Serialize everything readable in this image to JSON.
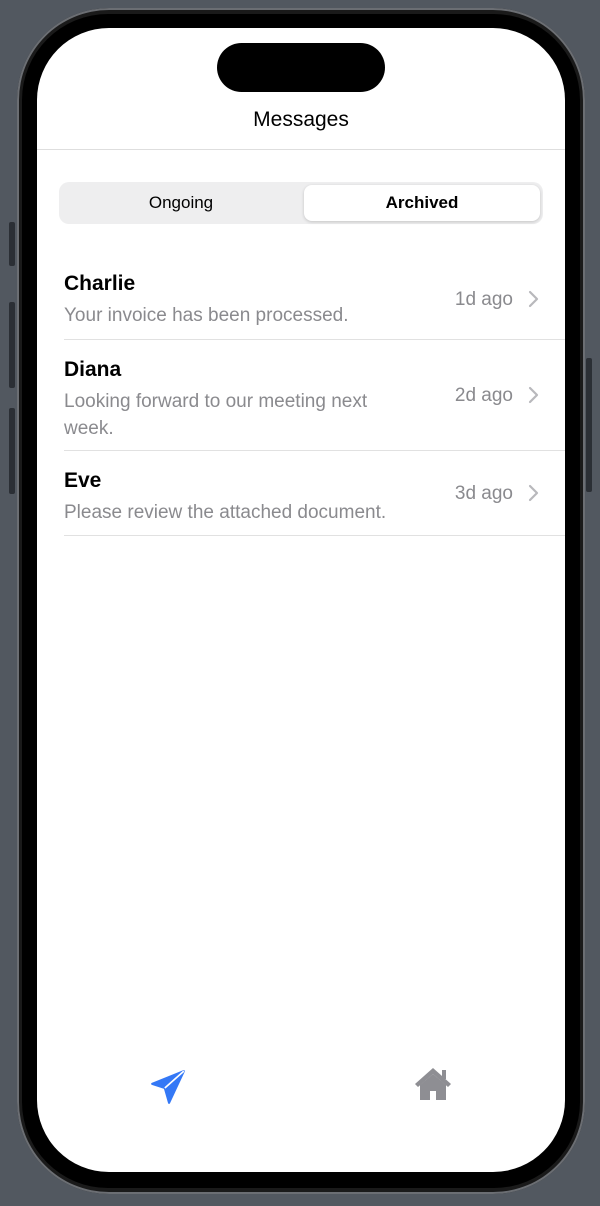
{
  "nav": {
    "title": "Messages"
  },
  "segments": {
    "ongoing_label": "Ongoing",
    "archived_label": "Archived",
    "selected": "Archived"
  },
  "messages": [
    {
      "name": "Charlie",
      "preview": "Your invoice has been processed.",
      "time": "1d ago"
    },
    {
      "name": "Diana",
      "preview": "Looking forward to our meeting next week.",
      "time": "2d ago"
    },
    {
      "name": "Eve",
      "preview": "Please review the attached document.",
      "time": "3d ago"
    }
  ],
  "tabbar": {
    "items": [
      {
        "icon": "paper-plane-icon",
        "active": true
      },
      {
        "icon": "house-icon",
        "active": false
      }
    ]
  },
  "colors": {
    "accent": "#3478f6",
    "secondary_text": "#8a8a8e",
    "inactive_icon": "#8e8e93"
  }
}
